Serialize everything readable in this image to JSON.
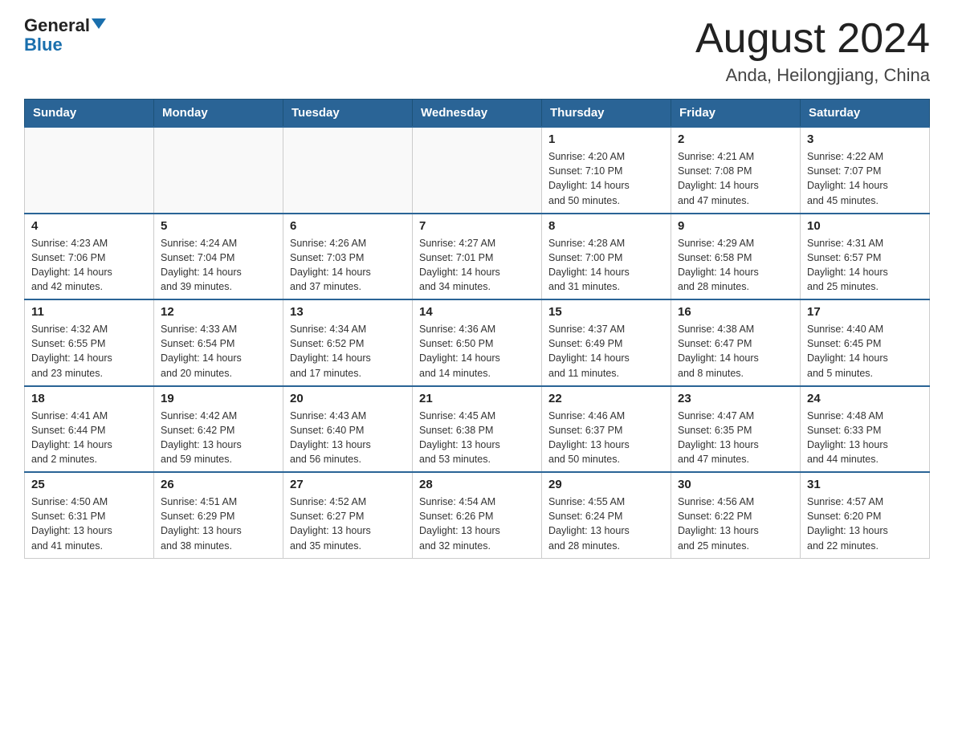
{
  "header": {
    "logo_line1": "General",
    "logo_line2": "Blue",
    "title": "August 2024",
    "subtitle": "Anda, Heilongjiang, China"
  },
  "weekdays": [
    "Sunday",
    "Monday",
    "Tuesday",
    "Wednesday",
    "Thursday",
    "Friday",
    "Saturday"
  ],
  "weeks": [
    [
      {
        "day": "",
        "info": ""
      },
      {
        "day": "",
        "info": ""
      },
      {
        "day": "",
        "info": ""
      },
      {
        "day": "",
        "info": ""
      },
      {
        "day": "1",
        "info": "Sunrise: 4:20 AM\nSunset: 7:10 PM\nDaylight: 14 hours\nand 50 minutes."
      },
      {
        "day": "2",
        "info": "Sunrise: 4:21 AM\nSunset: 7:08 PM\nDaylight: 14 hours\nand 47 minutes."
      },
      {
        "day": "3",
        "info": "Sunrise: 4:22 AM\nSunset: 7:07 PM\nDaylight: 14 hours\nand 45 minutes."
      }
    ],
    [
      {
        "day": "4",
        "info": "Sunrise: 4:23 AM\nSunset: 7:06 PM\nDaylight: 14 hours\nand 42 minutes."
      },
      {
        "day": "5",
        "info": "Sunrise: 4:24 AM\nSunset: 7:04 PM\nDaylight: 14 hours\nand 39 minutes."
      },
      {
        "day": "6",
        "info": "Sunrise: 4:26 AM\nSunset: 7:03 PM\nDaylight: 14 hours\nand 37 minutes."
      },
      {
        "day": "7",
        "info": "Sunrise: 4:27 AM\nSunset: 7:01 PM\nDaylight: 14 hours\nand 34 minutes."
      },
      {
        "day": "8",
        "info": "Sunrise: 4:28 AM\nSunset: 7:00 PM\nDaylight: 14 hours\nand 31 minutes."
      },
      {
        "day": "9",
        "info": "Sunrise: 4:29 AM\nSunset: 6:58 PM\nDaylight: 14 hours\nand 28 minutes."
      },
      {
        "day": "10",
        "info": "Sunrise: 4:31 AM\nSunset: 6:57 PM\nDaylight: 14 hours\nand 25 minutes."
      }
    ],
    [
      {
        "day": "11",
        "info": "Sunrise: 4:32 AM\nSunset: 6:55 PM\nDaylight: 14 hours\nand 23 minutes."
      },
      {
        "day": "12",
        "info": "Sunrise: 4:33 AM\nSunset: 6:54 PM\nDaylight: 14 hours\nand 20 minutes."
      },
      {
        "day": "13",
        "info": "Sunrise: 4:34 AM\nSunset: 6:52 PM\nDaylight: 14 hours\nand 17 minutes."
      },
      {
        "day": "14",
        "info": "Sunrise: 4:36 AM\nSunset: 6:50 PM\nDaylight: 14 hours\nand 14 minutes."
      },
      {
        "day": "15",
        "info": "Sunrise: 4:37 AM\nSunset: 6:49 PM\nDaylight: 14 hours\nand 11 minutes."
      },
      {
        "day": "16",
        "info": "Sunrise: 4:38 AM\nSunset: 6:47 PM\nDaylight: 14 hours\nand 8 minutes."
      },
      {
        "day": "17",
        "info": "Sunrise: 4:40 AM\nSunset: 6:45 PM\nDaylight: 14 hours\nand 5 minutes."
      }
    ],
    [
      {
        "day": "18",
        "info": "Sunrise: 4:41 AM\nSunset: 6:44 PM\nDaylight: 14 hours\nand 2 minutes."
      },
      {
        "day": "19",
        "info": "Sunrise: 4:42 AM\nSunset: 6:42 PM\nDaylight: 13 hours\nand 59 minutes."
      },
      {
        "day": "20",
        "info": "Sunrise: 4:43 AM\nSunset: 6:40 PM\nDaylight: 13 hours\nand 56 minutes."
      },
      {
        "day": "21",
        "info": "Sunrise: 4:45 AM\nSunset: 6:38 PM\nDaylight: 13 hours\nand 53 minutes."
      },
      {
        "day": "22",
        "info": "Sunrise: 4:46 AM\nSunset: 6:37 PM\nDaylight: 13 hours\nand 50 minutes."
      },
      {
        "day": "23",
        "info": "Sunrise: 4:47 AM\nSunset: 6:35 PM\nDaylight: 13 hours\nand 47 minutes."
      },
      {
        "day": "24",
        "info": "Sunrise: 4:48 AM\nSunset: 6:33 PM\nDaylight: 13 hours\nand 44 minutes."
      }
    ],
    [
      {
        "day": "25",
        "info": "Sunrise: 4:50 AM\nSunset: 6:31 PM\nDaylight: 13 hours\nand 41 minutes."
      },
      {
        "day": "26",
        "info": "Sunrise: 4:51 AM\nSunset: 6:29 PM\nDaylight: 13 hours\nand 38 minutes."
      },
      {
        "day": "27",
        "info": "Sunrise: 4:52 AM\nSunset: 6:27 PM\nDaylight: 13 hours\nand 35 minutes."
      },
      {
        "day": "28",
        "info": "Sunrise: 4:54 AM\nSunset: 6:26 PM\nDaylight: 13 hours\nand 32 minutes."
      },
      {
        "day": "29",
        "info": "Sunrise: 4:55 AM\nSunset: 6:24 PM\nDaylight: 13 hours\nand 28 minutes."
      },
      {
        "day": "30",
        "info": "Sunrise: 4:56 AM\nSunset: 6:22 PM\nDaylight: 13 hours\nand 25 minutes."
      },
      {
        "day": "31",
        "info": "Sunrise: 4:57 AM\nSunset: 6:20 PM\nDaylight: 13 hours\nand 22 minutes."
      }
    ]
  ]
}
